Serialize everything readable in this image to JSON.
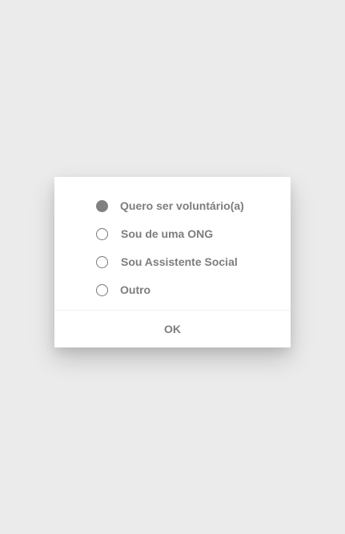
{
  "dialog": {
    "options": [
      {
        "label": "Quero ser voluntário(a)",
        "checked": true
      },
      {
        "label": "Sou de uma ONG",
        "checked": false
      },
      {
        "label": "Sou Assistente Social",
        "checked": false
      },
      {
        "label": "Outro",
        "checked": false
      }
    ],
    "ok_label": "OK"
  },
  "colors": {
    "background": "#ebebeb",
    "dialog": "#ffffff",
    "text": "#7d7d7d",
    "radio_checked": "#808080"
  }
}
